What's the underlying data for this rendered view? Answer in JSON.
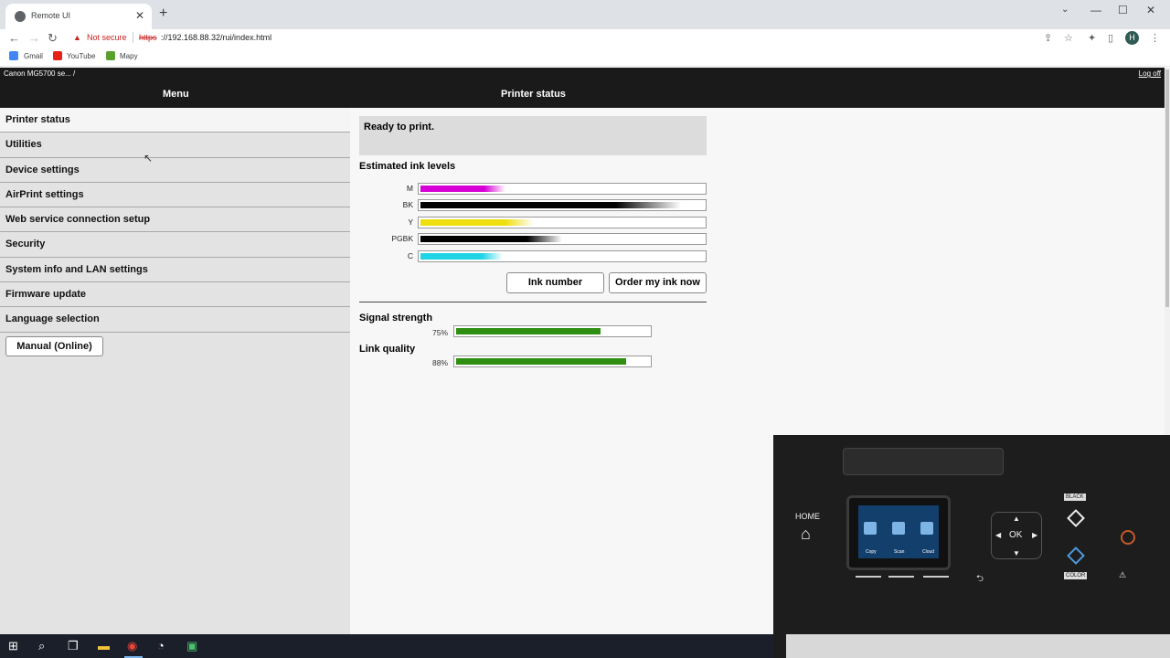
{
  "browser": {
    "tab_title": "Remote UI",
    "tab_close": "✕",
    "new_tab": "+",
    "not_secure": "Not secure",
    "url_scheme": "https",
    "url_rest": "://192.168.88.32/rui/index.html",
    "profile_initial": "H",
    "bookmarks": [
      "Gmail",
      "YouTube",
      "Mapy"
    ]
  },
  "header": {
    "device_name": "Canon MG5700 se... /",
    "log_off": "Log off",
    "menu_title": "Menu",
    "page_title": "Printer status"
  },
  "sidebar": {
    "items": [
      {
        "label": "Printer status"
      },
      {
        "label": "Utilities"
      },
      {
        "label": "Device settings"
      },
      {
        "label": "AirPrint settings"
      },
      {
        "label": "Web service connection setup"
      },
      {
        "label": "Security"
      },
      {
        "label": "System info and LAN settings"
      },
      {
        "label": "Firmware update"
      },
      {
        "label": "Language selection"
      }
    ],
    "manual_button": "Manual (Online)"
  },
  "status": {
    "message": "Ready to print."
  },
  "ink": {
    "heading": "Estimated ink levels",
    "levels": [
      {
        "label": "M",
        "level": 0.3,
        "color": "#d600d6"
      },
      {
        "label": "BK",
        "level": 0.92,
        "color": "#000000"
      },
      {
        "label": "Y",
        "level": 0.4,
        "color": "#f0df10"
      },
      {
        "label": "PGBK",
        "level": 0.5,
        "color": "#000000"
      },
      {
        "label": "C",
        "level": 0.29,
        "color": "#20d4e6"
      }
    ],
    "ink_number_button": "Ink number",
    "order_button": "Order my ink now"
  },
  "network": {
    "signal_label": "Signal strength",
    "signal_value": "75%",
    "signal_level": 0.75,
    "link_label": "Link quality",
    "link_value": "88%",
    "link_level": 0.88,
    "bar_color": "#2f8f12"
  },
  "overlay": {
    "home_label": "HOME",
    "screen_items": [
      "Copy",
      "Scan",
      "Cloud"
    ],
    "ok_label": "OK",
    "black_label": "BLACK",
    "color_label": "COLOR"
  }
}
